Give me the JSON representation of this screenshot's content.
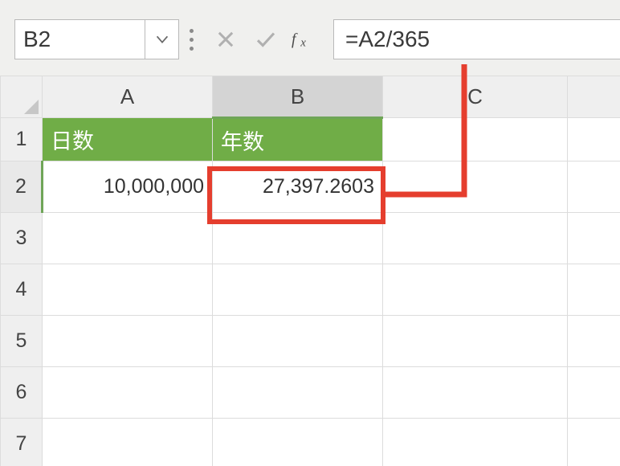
{
  "name_box": {
    "value": "B2"
  },
  "formula_bar": {
    "formula": "=A2/365"
  },
  "columns": [
    "A",
    "B",
    "C"
  ],
  "row_numbers": [
    1,
    2,
    3,
    4,
    5,
    6,
    7
  ],
  "cells": {
    "A1": "日数",
    "B1": "年数",
    "A2": "10,000,000",
    "B2": "27,397.2603"
  }
}
